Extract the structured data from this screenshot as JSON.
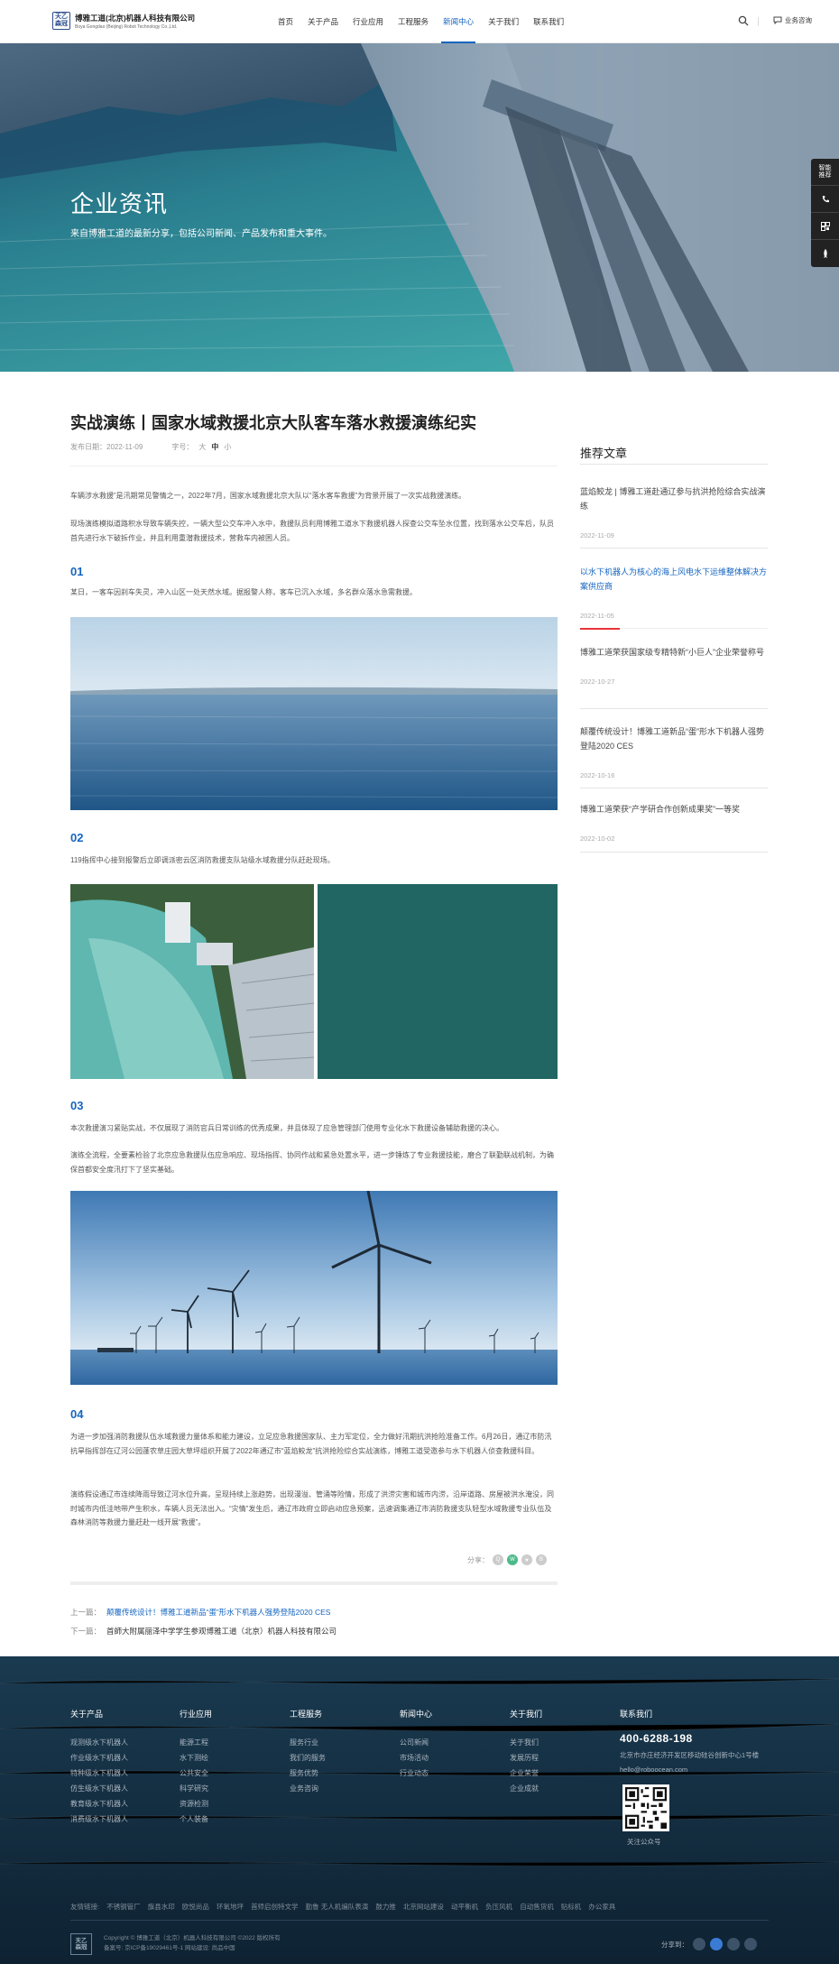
{
  "header": {
    "logo_mark_top": "天乙",
    "logo_mark_bottom": "森冠",
    "company_cn": "博雅工道(北京)机器人科技有限公司",
    "company_en": "Boya Gongdao (Beijing) Robot Technology Co.,Ltd.",
    "nav": [
      "首页",
      "关于产品",
      "行业应用",
      "工程服务",
      "新闻中心",
      "关于我们",
      "联系我们"
    ],
    "active_nav": "新闻中心",
    "consult_label": "业务咨询"
  },
  "banner": {
    "title": "企业资讯",
    "subtitle": "来自博雅工道的最新分享，包括公司新闻、产品发布和重大事件。"
  },
  "side_float": {
    "items": [
      "智能推荐",
      "phone-icon",
      "qrcode-icon",
      "rocket-icon"
    ],
    "first_label_line1": "智能",
    "first_label_line2": "推荐"
  },
  "article": {
    "title": "实战演练丨国家水域救援北京大队客车落水救援演练纪实",
    "date_label": "发布日期：2022-11-09",
    "font_size_label": "字号：",
    "font_sizes": [
      "大",
      "中",
      "小"
    ],
    "intro": [
      "车辆涉水救援”是汛期常见警情之一，2022年7月，国家水域救援北京大队以“落水客车救援”为背景开展了一次实战救援演练。",
      "现场演练模拟道路积水导致车辆失控，一辆大型公交车冲入水中，救援队员利用博雅工道水下救援机器人探查公交车坠水位置，找到落水公交车后，队员首先进行水下破拆作业，并且利用重潜救援技术，营救车内被困人员。"
    ],
    "sections": [
      {
        "num": "01",
        "paragraphs": [
          "某日，一客车因刹车失灵，冲入山区一处天然水域。据报警人称，客车已沉入水域，多名群众落水急需救援。"
        ]
      },
      {
        "num": "02",
        "paragraphs": [
          "119指挥中心接到报警后立即调派密云区消防救援支队站级水域救援分队赶赴现场。"
        ]
      },
      {
        "num": "03",
        "paragraphs": [
          "本次救援演习紧贴实战，不仅展现了消防官兵日常训练的优秀成果，并且体现了应急管理部门使用专业化水下救援设备辅助救援的决心。",
          "演练全流程，全要素检验了北京应急救援队伍应急响应、现场指挥、协同作战和紧急处置水平，进一步锤炼了专业救援技能，磨合了联勤联战机制，为确保首都安全度汛打下了坚实基础。"
        ]
      },
      {
        "num": "04",
        "paragraphs": [
          "为进一步加强消防救援队伍水域救援力量体系和能力建设，立足应急救援国家队、主力军定位，全力做好汛期抗洪抢险准备工作。6月26日，通辽市防汛抗旱指挥部在辽河公园蓬农草庄园大草坪组织开展了2022年通辽市“蓝焰鲛龙”抗洪抢险综合实战演练，博雅工道受邀参与水下机器人侦查救援科目。",
          "演练假设通辽市连续降雨导致辽河水位升高，呈现持续上涨趋势，出现漫溢、管涌等险情，形成了洪涝灾害和城市内涝，沿岸道路、房屋被洪水淹没，同时城市内低洼地带产生积水，车辆人员无法出入。“灾情”发生后，通辽市政府立即启动应急预案，迅速调集通辽市消防救援支队轻型水域救援专业队伍及森林消防等救援力量赶赴一线开展“救援”。"
        ]
      }
    ],
    "share_label": "分享：",
    "prev_label": "上一篇：",
    "prev_title": "颠覆传统设计！博雅工道新品“蛋”形水下机器人强势登陆2020 CES",
    "next_label": "下一篇：",
    "next_title": "首師大附属丽泽中学学生参观博雅工道（北京）机器人科技有限公司"
  },
  "sidebar": {
    "title": "推荐文章",
    "items": [
      {
        "title": "蓝焰鲛龙 | 博雅工道赴通辽参与抗洪抢险综合实战演练",
        "date": "2022-11-09"
      },
      {
        "title": "以水下机器人为核心的海上风电水下运维整体解决方案供应商",
        "date": "2022-11-05"
      },
      {
        "title": "博雅工道荣获国家级专精特新“小巨人”企业荣誉称号",
        "date": "2022-10-27"
      },
      {
        "title": "颠覆传统设计！博雅工道新品“蛋”形水下机器人强势登陆2020 CES",
        "date": "2022-10-16"
      },
      {
        "title": "博雅工道荣获“产学研合作创新成果奖”一等奖",
        "date": "2022-10-02"
      }
    ]
  },
  "footer": {
    "columns": [
      {
        "title": "关于产品",
        "links": [
          "观测级水下机器人",
          "作业级水下机器人",
          "特种级水下机器人",
          "仿生级水下机器人",
          "教育级水下机器人",
          "消费级水下机器人"
        ]
      },
      {
        "title": "行业应用",
        "links": [
          "能源工程",
          "水下测绘",
          "公共安全",
          "科学研究",
          "资源检测",
          "个人装备"
        ]
      },
      {
        "title": "工程服务",
        "links": [
          "服务行业",
          "我们的服务",
          "服务优势",
          "业务咨询"
        ]
      },
      {
        "title": "新闻中心",
        "links": [
          "公司新闻",
          "市场活动",
          "行业动态"
        ]
      },
      {
        "title": "关于我们",
        "links": [
          "关于我们",
          "发展历程",
          "企业荣誉",
          "企业成就"
        ]
      }
    ],
    "contact_title": "联系我们",
    "phone": "400-6288-198",
    "address": "北京市亦庄经济开发区移动硅谷创新中心1号楼",
    "email": "hello@roboocean.com",
    "qr_caption": "关注公众号",
    "friend_links": [
      "友情链接:",
      "不锈钢管厂",
      "旗县水印",
      "欧悦尚品",
      "环氧地坪",
      "首师启创特文学",
      "勤鲁 无人机编队表演",
      "鼓力推",
      "北京网站建设",
      "动平衡机",
      "负压风机",
      "自动售货机",
      "贴标机",
      "办公家具"
    ],
    "copyright": "Copyright © 博雅工道（北京）机器人科技有限公司 ©2022 版权所有",
    "icp": "备案号: 京ICP备19029461号-1 网站建设: 尚品中国",
    "share_label": "分享到："
  }
}
